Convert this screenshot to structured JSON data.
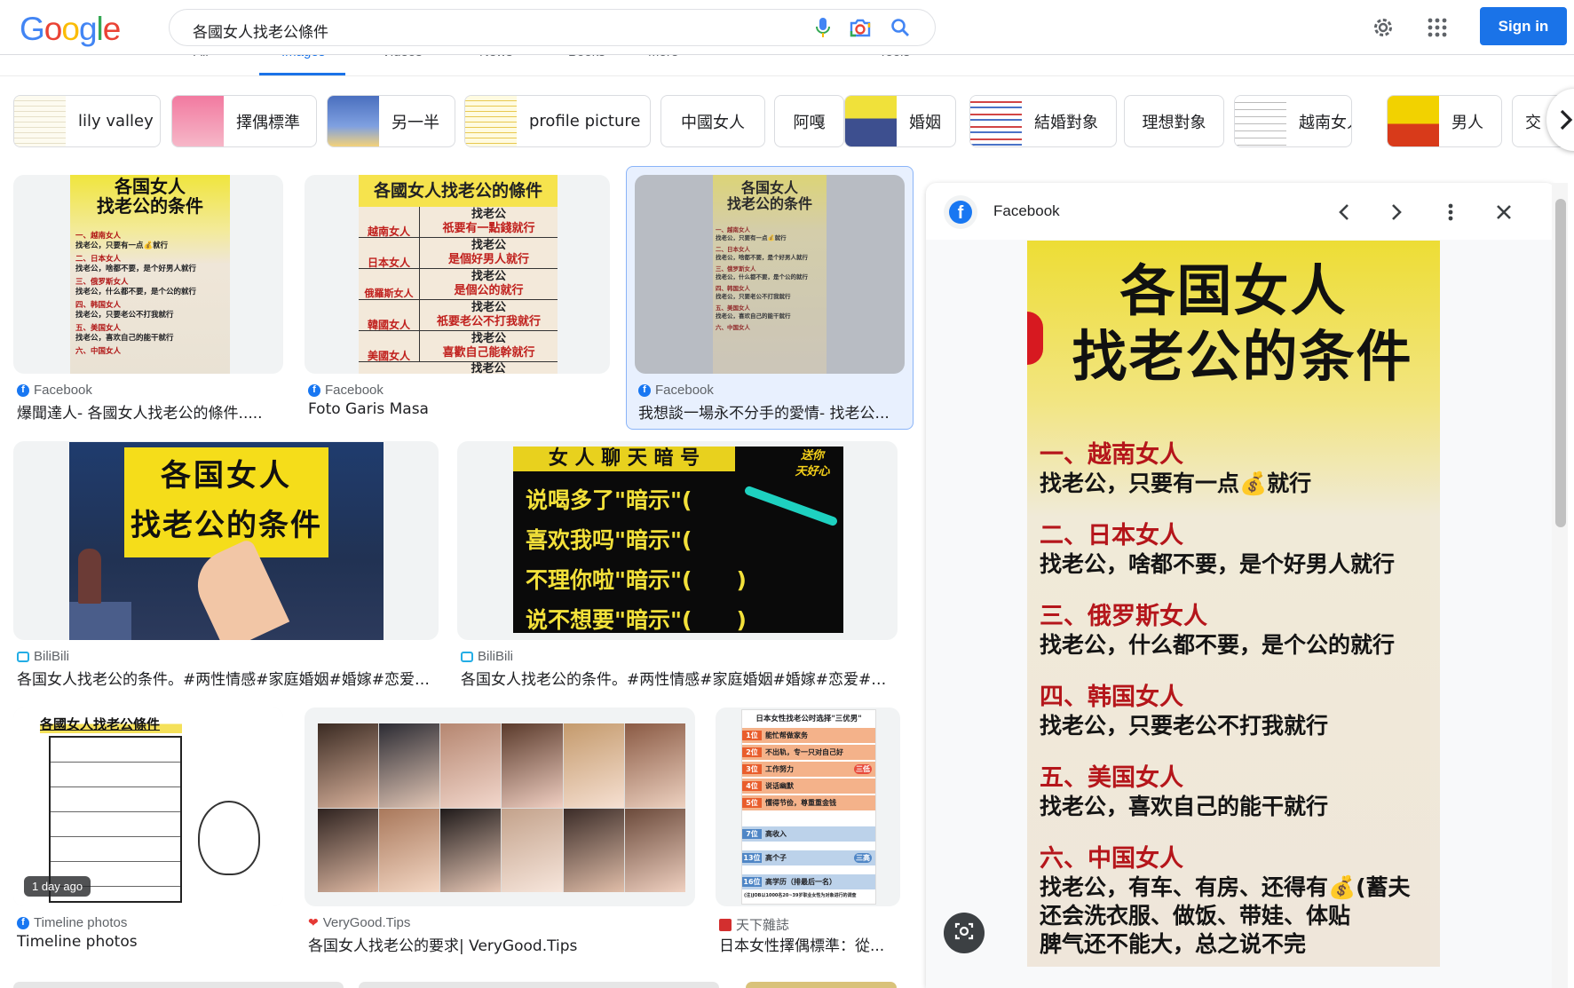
{
  "header": {
    "logo": "Google",
    "search_value": "各國女人找老公條件",
    "signin_label": "Sign in"
  },
  "tabs": [
    "All",
    "Images",
    "Videos",
    "News",
    "Books",
    "More",
    "Tools"
  ],
  "chips": [
    {
      "label": "lily valley"
    },
    {
      "label": "擇偶標準"
    },
    {
      "label": "另一半"
    },
    {
      "label": "profile picture"
    },
    {
      "label": "中國女人"
    },
    {
      "label": "阿嘎"
    },
    {
      "label": "婚姻"
    },
    {
      "label": "結婚對象"
    },
    {
      "label": "理想對象"
    },
    {
      "label": "越南女人"
    },
    {
      "label": "男人"
    },
    {
      "label": "交"
    }
  ],
  "results": [
    {
      "source": "Facebook",
      "title": "爆聞達人- 各國女人找老公的條件.....",
      "badge": ""
    },
    {
      "source": "Facebook",
      "title": "Foto Garis Masa",
      "badge": ""
    },
    {
      "source": "Facebook",
      "title": "我想談一場永不分手的愛情- 找老公...",
      "badge": ""
    },
    {
      "source": "BiliBili",
      "title": "各国女人找老公的条件。#两性情感#家庭婚姻#婚嫁#恋爱#...",
      "badge": ""
    },
    {
      "source": "BiliBili",
      "title": "各国女人找老公的条件。#两性情感#家庭婚姻#婚嫁#恋爱#手...",
      "badge": ""
    },
    {
      "source": "Timeline photos",
      "title": "Timeline photos",
      "badge": "1 day ago"
    },
    {
      "source": "VeryGood.Tips",
      "title": "各国女人找老公的要求| VeryGood.Tips",
      "badge": ""
    },
    {
      "source": "天下雜誌",
      "title": "日本女性擇偶標準：從...",
      "badge": ""
    }
  ],
  "posters": {
    "p1_title": [
      "各国女人",
      "找老公的条件"
    ],
    "p1_lines": [
      "一、越南女人",
      "找老公，只要有一点💰就行",
      "二、日本女人",
      "找老公，啥都不要，是个好男人就行",
      "三、俄罗斯女人",
      "找老公，什么都不要，是个公的就行",
      "四、韩国女人",
      "找老公，只要老公不打我就行",
      "五、美国女人",
      "找老公，喜欢自己的能干就行",
      "六、中国女人"
    ],
    "p2_title": "各國女人找老公的條件",
    "p2_rows": [
      {
        "country": "越南女人",
        "line1": "找老公",
        "line2": "祇要有一點錢就行"
      },
      {
        "country": "日本女人",
        "line1": "找老公",
        "line2": "是個好男人就行"
      },
      {
        "country": "俄羅斯女人",
        "line1": "找老公",
        "line2": "是個公的就行"
      },
      {
        "country": "韓國女人",
        "line1": "找老公",
        "line2": "祇要老公不打我就行"
      },
      {
        "country": "美國女人",
        "line1": "找老公",
        "line2": "喜歡自己能幹就行"
      }
    ],
    "p2_last": "找老公",
    "p4_title": [
      "各国女人",
      "找老公的条件"
    ],
    "p5_lines": [
      "女 人 聊 天 暗 号",
      "说喝多了\"暗示\"(",
      "喜欢我吗\"暗示\"(",
      "不理你啦\"暗示\"(　　)",
      "说不想要\"暗示\"(　　)"
    ],
    "p5_sticker": [
      "送你",
      "天好心"
    ],
    "p6_title": "各國女人找老公條件",
    "p8_title": "日本女性找老公时选择\"三优男\"",
    "p8_rows": [
      {
        "rank": "1位",
        "text": "能忙帮做家务"
      },
      {
        "rank": "2位",
        "text": "不出轨，专一只对自己好"
      },
      {
        "rank": "3位",
        "text": "工作努力"
      },
      {
        "rank": "4位",
        "text": "说话幽默"
      },
      {
        "rank": "5位",
        "text": "懂得节俭，尊重重金钱"
      },
      {
        "rank": "7位",
        "text": "高收入"
      },
      {
        "rank": "13位",
        "text": "高个子"
      },
      {
        "rank": "16位",
        "text": "高学历（排最后一名）"
      }
    ],
    "p8_tags": [
      "三低",
      "三高"
    ],
    "p8_note": "(注)JOB以1000名20~39岁职业女性为对象进行的调查"
  },
  "panel": {
    "source": "Facebook",
    "image_title": [
      "各国女人",
      "找老公的条件"
    ],
    "image_lines": [
      {
        "heading": "一、越南女人",
        "text": "找老公，只要有一点💰就行"
      },
      {
        "heading": "二、日本女人",
        "text": "找老公，啥都不要，是个好男人就行"
      },
      {
        "heading": "三、俄罗斯女人",
        "text": "找老公，什么都不要，是个公的就行"
      },
      {
        "heading": "四、韩国女人",
        "text": "找老公，只要老公不打我就行"
      },
      {
        "heading": "五、美国女人",
        "text": "找老公，喜欢自己的能干就行"
      },
      {
        "heading": "六、中国女人",
        "text": "找老公，有车、有房、还得有💰(蓄夫"
      }
    ],
    "image_tail": [
      "还会洗衣服、做饭、带娃、体贴",
      "脾气还不能大，总之说不完"
    ]
  },
  "colors": {
    "brand_blue": "#1a73e8",
    "facebook_blue": "#1877f2",
    "poster_yellow": "#f2e23a",
    "poster_red": "#d71920"
  }
}
